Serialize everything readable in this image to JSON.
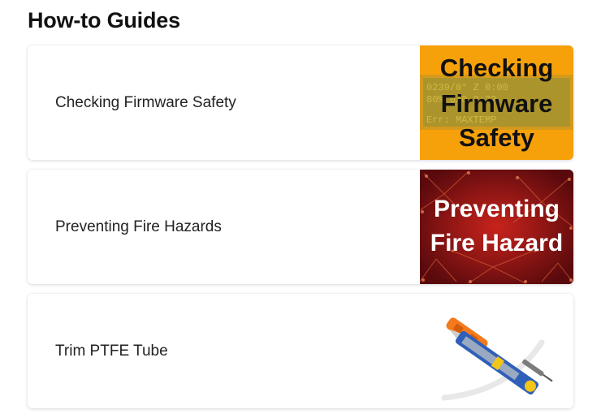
{
  "header": {
    "title": "How-to Guides"
  },
  "guides": [
    {
      "label": "Checking Firmware Safety",
      "thumb": {
        "lines": [
          "Checking",
          "Firmware",
          "Safety"
        ],
        "lcd_line1": "0239/0°     Z  0:00",
        "lcd_line2": "80%  0/0      ?:??",
        "lcd_line3": "Err: MAXTEMP",
        "bg_color": "#f7a10a"
      }
    },
    {
      "label": "Preventing Fire Hazards",
      "thumb": {
        "lines": [
          "Preventing",
          "Fire Hazard"
        ],
        "bg_color": "#7a0d12"
      }
    },
    {
      "label": "Trim PTFE Tube",
      "thumb": {
        "icon": "tube-cutter-tools-icon"
      }
    }
  ],
  "colors": {
    "title": "#111111",
    "accent_orange": "#f7a10a",
    "fire_red": "#7a0d12"
  }
}
